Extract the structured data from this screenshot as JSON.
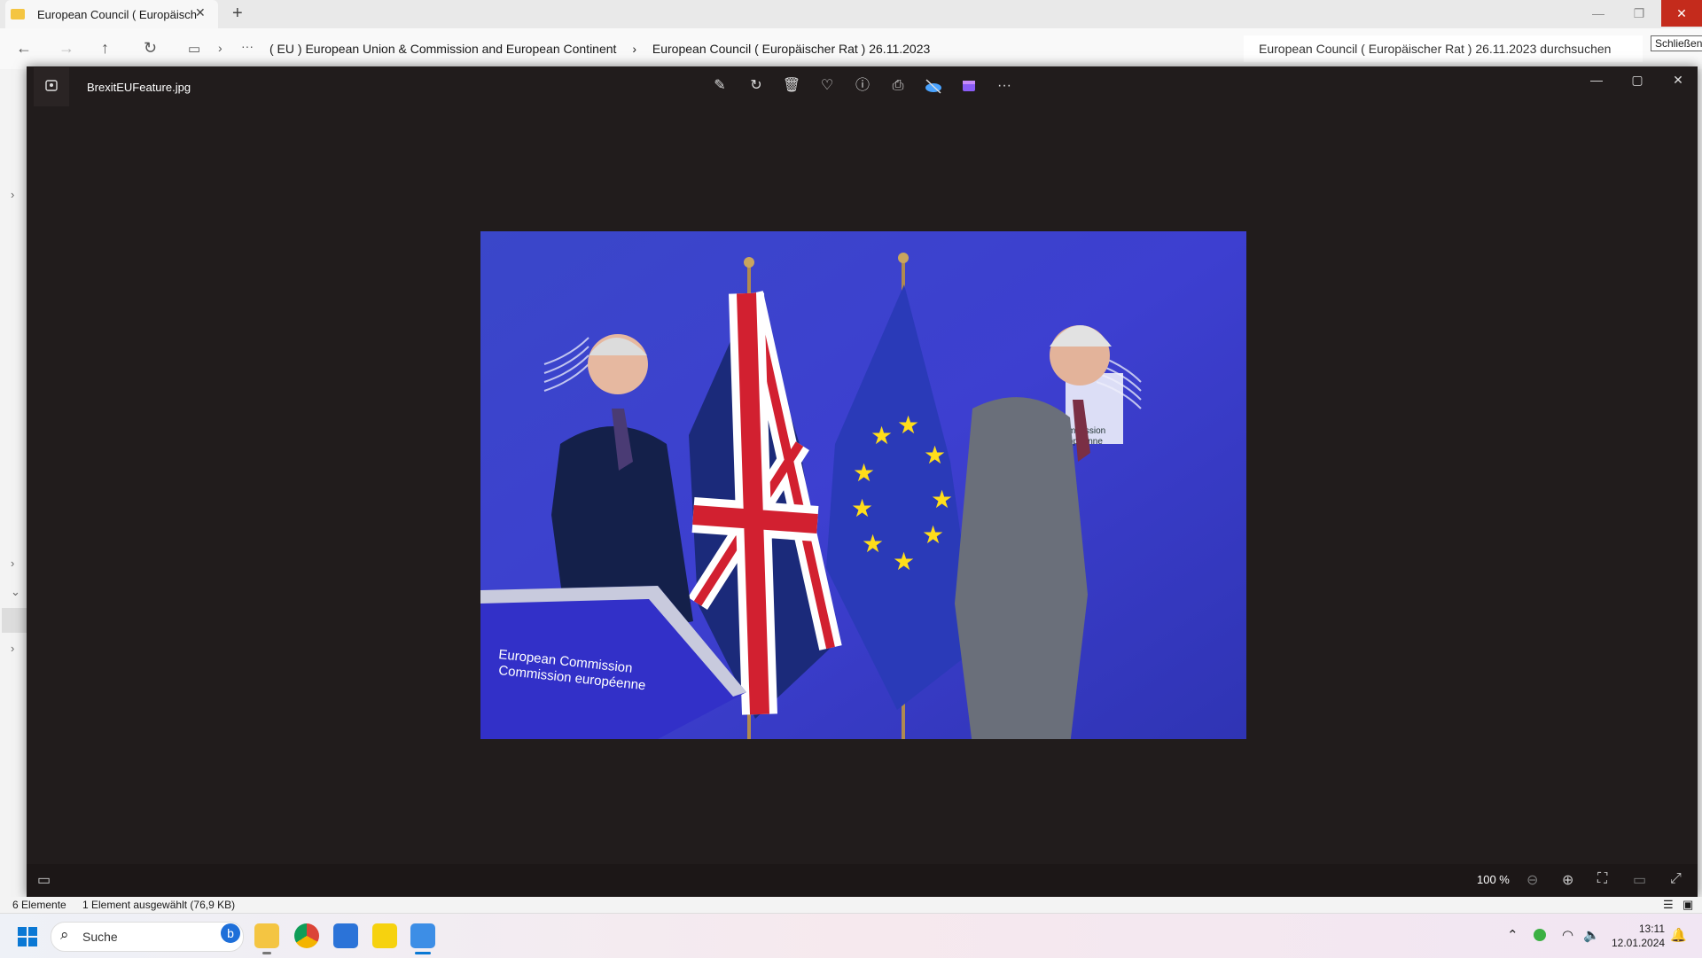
{
  "explorer": {
    "tab_title": "European Council ( Europäisch",
    "breadcrumb": [
      "( EU ) European Union & Commission and European Continent",
      "European Council ( Europäischer Rat ) 26.11.2023"
    ],
    "search_placeholder": "European Council ( Europäischer Rat ) 26.11.2023 durchsuchen",
    "tooltip": "Schließen",
    "status_items": "6 Elemente",
    "status_selected": "1 Element ausgewählt (76,9 KB)"
  },
  "viewer": {
    "filename": "BrexitEUFeature.jpg",
    "zoom": "100 %",
    "podium_text": [
      "European Commission",
      "Commission européenne"
    ],
    "logo_text": [
      "mmission",
      "opéenne"
    ]
  },
  "taskbar": {
    "search_label": "Suche",
    "time": "13:11",
    "date": "12.01.2024"
  },
  "colors": {
    "close_red": "#c42b1c",
    "viewer_bg": "#211c1c",
    "photo_blue": "#3a3fc8"
  }
}
